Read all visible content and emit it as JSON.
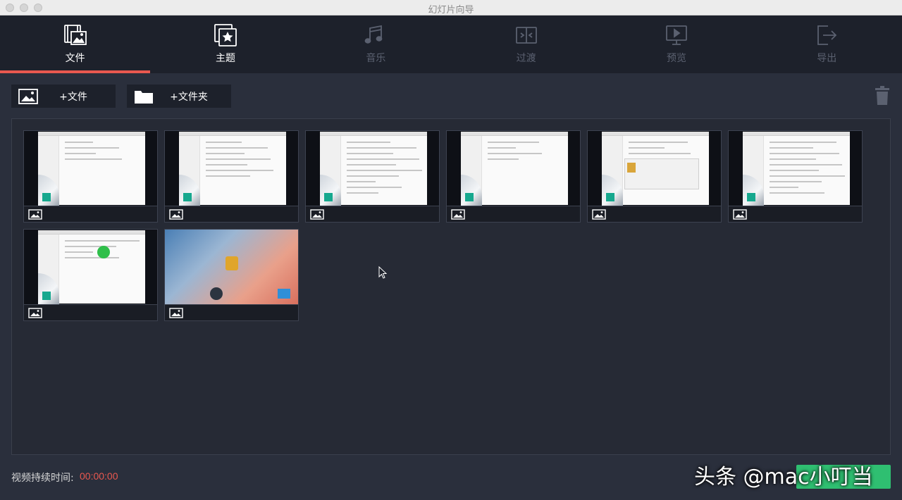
{
  "window": {
    "title": "幻灯片向导"
  },
  "steps": [
    {
      "label": "文件",
      "icon": "film-image-icon",
      "active": true
    },
    {
      "label": "主题",
      "icon": "theme-star-icon",
      "active": false
    },
    {
      "label": "音乐",
      "icon": "music-note-icon",
      "active": false
    },
    {
      "label": "过渡",
      "icon": "transition-icon",
      "active": false
    },
    {
      "label": "预览",
      "icon": "preview-play-icon",
      "active": false
    },
    {
      "label": "导出",
      "icon": "export-icon",
      "active": false
    }
  ],
  "toolbar": {
    "add_file_label": "+文件",
    "add_folder_label": "+文件夹"
  },
  "media": {
    "tile_count": 8,
    "tile_type_icon": "image-icon"
  },
  "footer": {
    "duration_label": "视频持续时间:",
    "duration_value": "00:00:00"
  },
  "overlay": {
    "caption": "头条 @mac小叮当"
  },
  "colors": {
    "accent": "#e9584f",
    "toolbar_bg": "#1d212b",
    "body_bg": "#2a2f3c",
    "green": "#2fbf71"
  }
}
